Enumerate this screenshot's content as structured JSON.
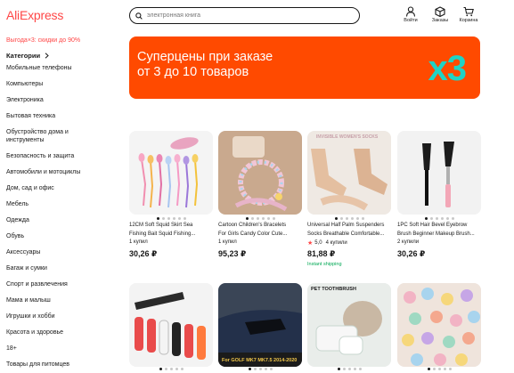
{
  "header": {
    "logo": "AliExpress",
    "search_placeholder": "электронная книга",
    "icons": [
      {
        "name": "account",
        "label": "Войти"
      },
      {
        "name": "orders",
        "label": "Заказы"
      },
      {
        "name": "cart",
        "label": "Корзина"
      }
    ]
  },
  "sidebar": {
    "promo": "Выгода×3: скидки до 90%",
    "categories_title": "Категории",
    "items": [
      "Мобильные телефоны",
      "Компьютеры",
      "Электроника",
      "Бытовая техника",
      "Обустройство дома и инструменты",
      "Безопасность и защита",
      "Автомобили и мотоциклы",
      "Дом, сад и офис",
      "Мебель",
      "Одежда",
      "Обувь",
      "Аксессуары",
      "Багаж и сумки",
      "Спорт и развлечения",
      "Мама и малыш",
      "Игрушки и хобби",
      "Красота и здоровье",
      "18+",
      "Товары для питомцев"
    ]
  },
  "banner": {
    "line1": "Суперцены при заказе",
    "line2": "от 3 до 10 товаров",
    "badge": "x3",
    "background": "#ff4a00",
    "badge_color": "#1fd3c5"
  },
  "products": [
    {
      "title_line1": "12CM Soft Squid Skirt Sea",
      "title_line2": "Fishing Bait Squid Fishing...",
      "sold": "1 купил",
      "price": "30,26 ₽"
    },
    {
      "title_line1": "Cartoon Children's Bracelets",
      "title_line2": "For Girls Candy Color Cute...",
      "sold": "1 купил",
      "price": "95,23 ₽"
    },
    {
      "title_line1": "Universal Half Palm Suspenders",
      "title_line2": "Socks Breathable Comfortable...",
      "rating": "5,0",
      "sold": "4 купили",
      "price": "81,88 ₽",
      "shipping": "Instant shipping",
      "image_text": "INVISIBLE WOMEN'S SOCKS"
    },
    {
      "title_line1": "1PC Soft Hair Bevel Eyebrow",
      "title_line2": "Brush Beginner Makeup Brush...",
      "sold": "2 купили",
      "price": "30,26 ₽"
    }
  ],
  "products_row2": [
    {
      "image_text": ""
    },
    {
      "image_text": "For GOLF MK7 MK7.5 2014-2020"
    },
    {
      "image_text": "PET TOOTHBRUSH"
    },
    {
      "image_text": ""
    }
  ],
  "colors": {
    "brand_red": "#ff4747",
    "shipping_green": "#00a854"
  }
}
